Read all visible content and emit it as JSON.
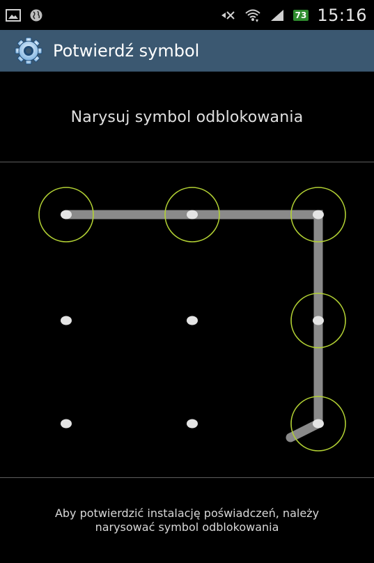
{
  "status_bar": {
    "time": "15:16",
    "battery_level": "73",
    "icons": [
      "gallery-icon",
      "globe-icon",
      "mute-icon",
      "wifi-icon",
      "signal-icon"
    ]
  },
  "action_bar": {
    "title": "Potwierdź symbol",
    "icon": "settings-gear-icon"
  },
  "instruction": "Narysuj symbol odblokowania",
  "pattern": {
    "rows": 3,
    "cols": 3,
    "selected_sequence": [
      1,
      2,
      3,
      6,
      9
    ],
    "accent_color": "#b3d234",
    "line_color": "#8a8a8a"
  },
  "footer_text": "Aby potwierdzić instalację poświadczeń, należy\nnarysować symbol odblokowania"
}
